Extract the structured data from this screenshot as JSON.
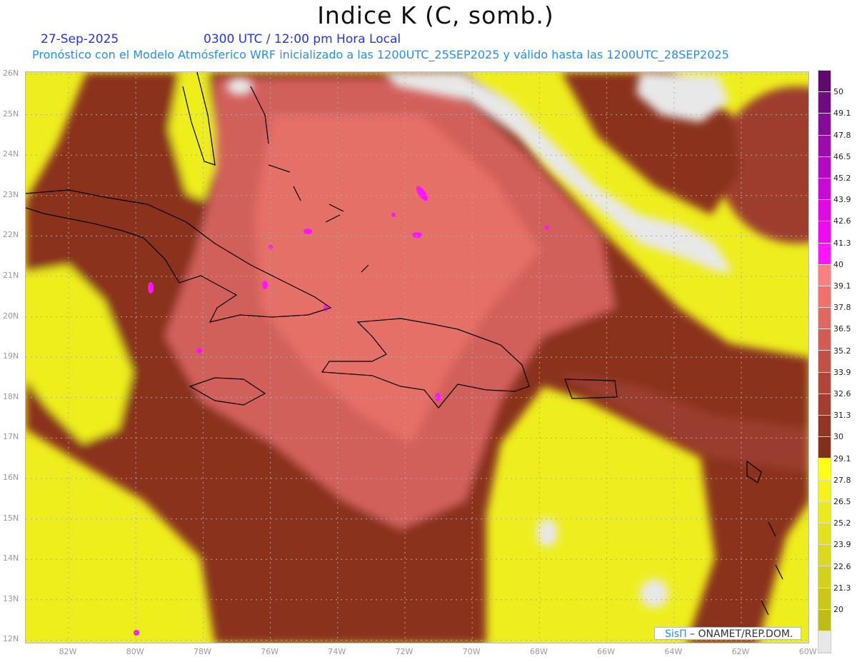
{
  "header": {
    "title": "Indice K (C, somb.)",
    "date": "27-Sep-2025",
    "time": "0300 UTC / 12:00 pm Hora Local",
    "subtitle": "Pronóstico con el Modelo Atmósferico WRF inicializado a las 1200UTC_25SEP2025 y válido hasta las  1200UTC_28SEP2025"
  },
  "map": {
    "lat_labels": [
      "26N",
      "25N",
      "24N",
      "23N",
      "22N",
      "21N",
      "20N",
      "19N",
      "18N",
      "17N",
      "16N",
      "15N",
      "14N",
      "13N",
      "12N"
    ],
    "lat_values": [
      26,
      25,
      24,
      23,
      22,
      21,
      20,
      19,
      18,
      17,
      16,
      15,
      14,
      13,
      12
    ],
    "lon_labels": [
      "82W",
      "80W",
      "78W",
      "76W",
      "74W",
      "72W",
      "70W",
      "68W",
      "66W",
      "64W",
      "62W",
      "60W"
    ],
    "lon_values": [
      -82,
      -80,
      -78,
      -76,
      -74,
      -72,
      -70,
      -68,
      -66,
      -64,
      -62,
      -60
    ]
  },
  "colorbar": {
    "labels": [
      "50",
      "49.1",
      "47.8",
      "46.5",
      "45.2",
      "43.9",
      "42.6",
      "41.3",
      "40",
      "39.1",
      "37.8",
      "36.5",
      "35.2",
      "33.9",
      "32.6",
      "31.3",
      "30",
      "29.1",
      "27.8",
      "26.5",
      "25.2",
      "23.9",
      "22.6",
      "21.3",
      "20"
    ],
    "colors": [
      "#5e0a6c",
      "#6f0b80",
      "#840c96",
      "#9b0bad",
      "#b20ac3",
      "#c90ad6",
      "#dd0ae4",
      "#f00af2",
      "#ff14ff",
      "#f98080",
      "#ee716c",
      "#e06862",
      "#d15c53",
      "#bf5146",
      "#ae473b",
      "#9f3e31",
      "#903627",
      "#82301b",
      "#ffff18",
      "#f5f31e",
      "#ebea20",
      "#e2e11f",
      "#dad91e",
      "#d2d11d",
      "#c8c71b",
      "#bdbd1a",
      "#e8e8e8"
    ]
  },
  "credit": {
    "brand": "SisΠ",
    "text": " –  ONAMET/REP.DOM."
  }
}
